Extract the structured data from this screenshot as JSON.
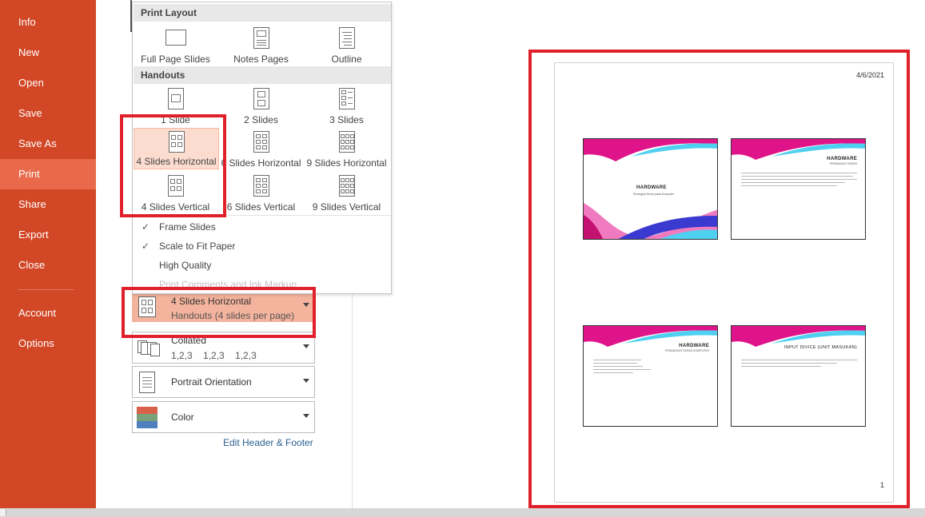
{
  "nav": {
    "items": [
      {
        "label": "Info"
      },
      {
        "label": "New"
      },
      {
        "label": "Open"
      },
      {
        "label": "Save"
      },
      {
        "label": "Save As"
      },
      {
        "label": "Print"
      },
      {
        "label": "Share"
      },
      {
        "label": "Export"
      },
      {
        "label": "Close"
      },
      {
        "label": "Account"
      },
      {
        "label": "Options"
      }
    ],
    "active": "Print"
  },
  "layout_menu": {
    "print_layout_header": "Print Layout",
    "print_layout": [
      "Full Page Slides",
      "Notes Pages",
      "Outline"
    ],
    "handouts_header": "Handouts",
    "handouts": [
      "1 Slide",
      "2 Slides",
      "3 Slides",
      "4 Slides Horizontal",
      "6 Slides Horizontal",
      "9 Slides Horizontal",
      "4 Slides Vertical",
      "6 Slides Vertical",
      "9 Slides Vertical"
    ],
    "selected": "4 Slides Horizontal",
    "options": [
      {
        "label": "Frame Slides",
        "checked": true
      },
      {
        "label": "Scale to Fit Paper",
        "checked": true
      },
      {
        "label": "High Quality",
        "checked": false
      },
      {
        "label": "Print Comments and Ink Markup",
        "checked": false,
        "disabled": true
      }
    ]
  },
  "settings": {
    "layout": {
      "title": "4 Slides Horizontal",
      "subtitle": "Handouts (4 slides per page)"
    },
    "collation": {
      "title": "Collated",
      "subtitle": "1,2,3    1,2,3    1,2,3"
    },
    "orientation": {
      "title": "Portrait Orientation"
    },
    "color": {
      "title": "Color"
    },
    "edit_header_footer": "Edit Header & Footer"
  },
  "preview": {
    "date": "4/6/2021",
    "page_number": "1",
    "slides": [
      {
        "title": "HARDWARE",
        "subtitle": "Perangkat Keras pada Komputer"
      },
      {
        "title": "HARDWARE",
        "subtitle": "PERANGKAT KERAS"
      },
      {
        "title": "HARDWARE",
        "subtitle": "PERANGKAT KERAS KOMPUTER"
      },
      {
        "title": "INPUT DIVICE (UNIT MASUKAN)",
        "subtitle": ""
      }
    ]
  },
  "colors": {
    "sidebar": "#d24726",
    "sidebar_active": "#e86a4b",
    "highlight": "#f4b39c",
    "callout": "#e0202a",
    "slide_band_magenta": "#e0148a",
    "slide_band_blue": "#3a3ad0",
    "slide_band_cyan": "#4fd0f0"
  }
}
